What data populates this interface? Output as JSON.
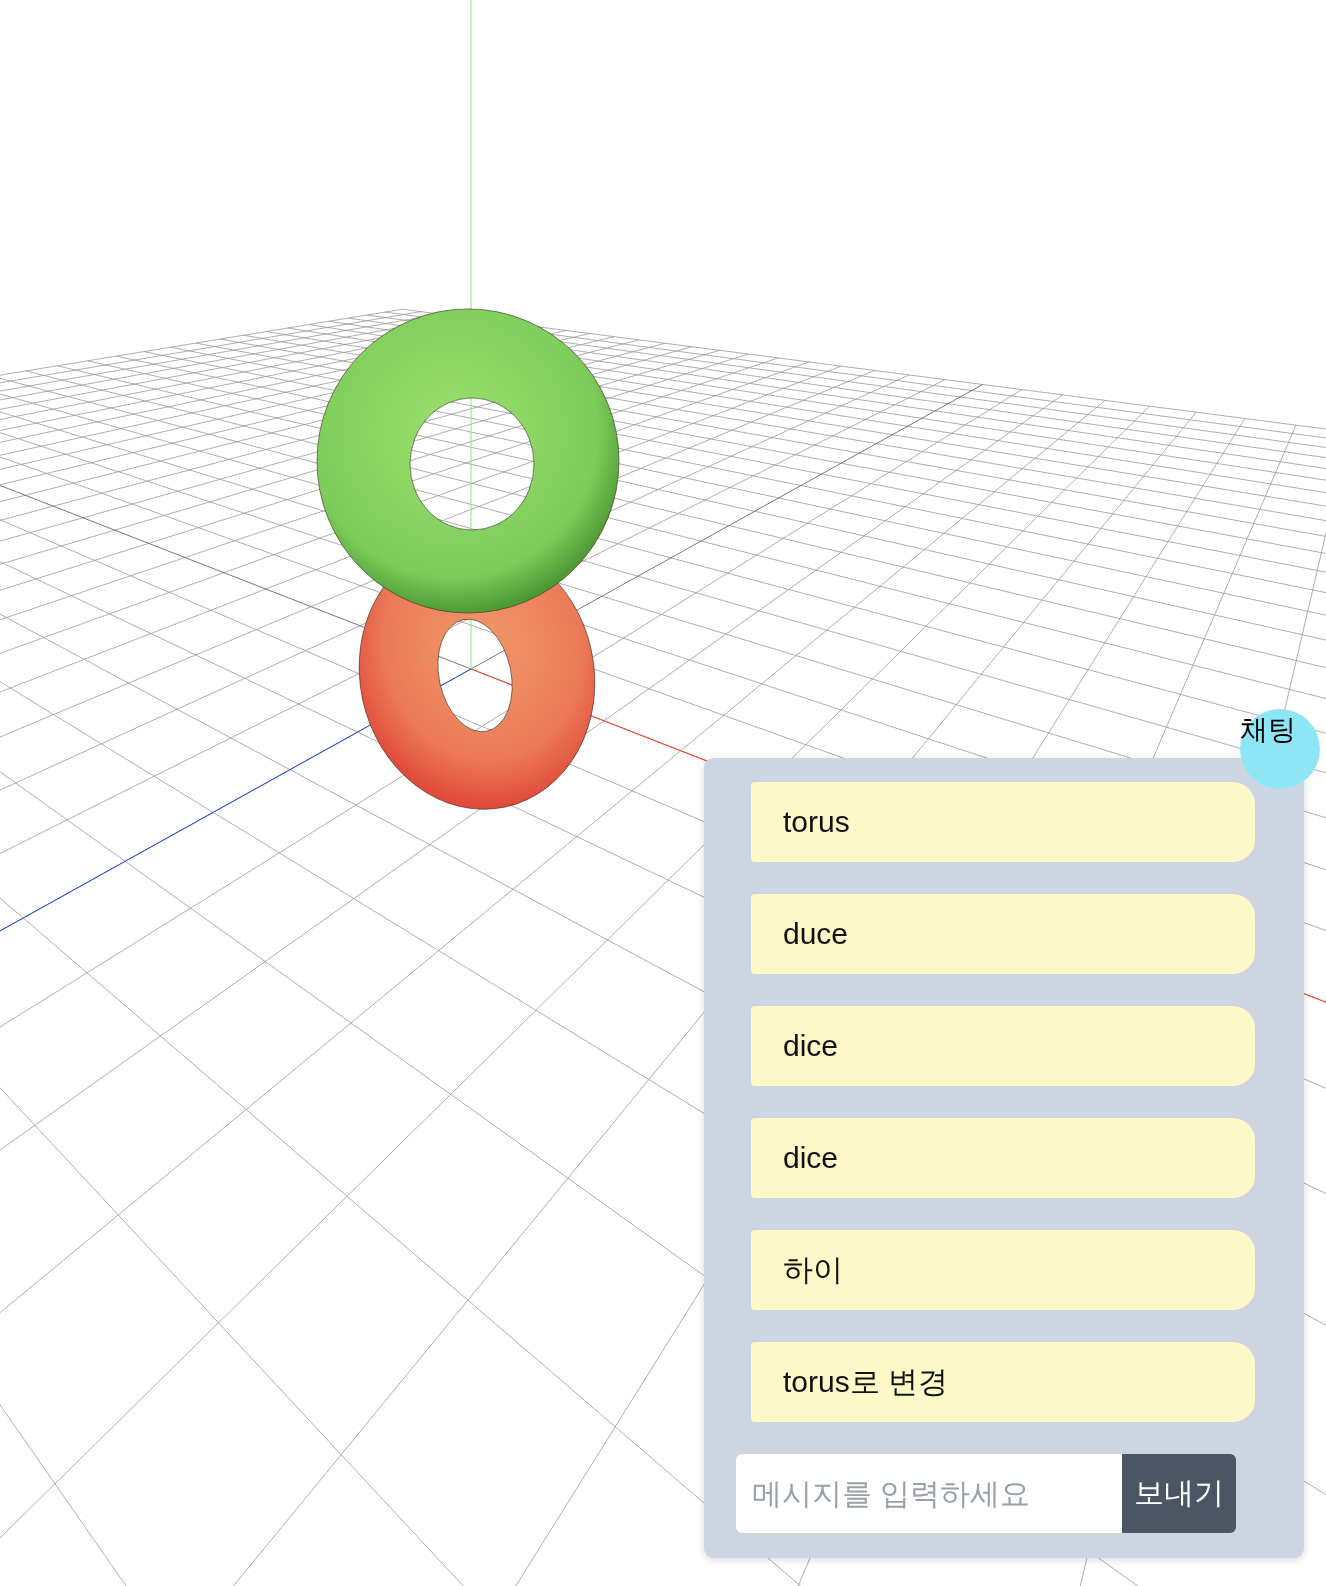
{
  "chat": {
    "toggle": "채팅",
    "messages": [
      "torus",
      "duce",
      "dice",
      "dice",
      "하이",
      "torus로 변경"
    ],
    "input": {
      "placeholder": "메시지를 입력하세요"
    },
    "send": "보내기"
  }
}
